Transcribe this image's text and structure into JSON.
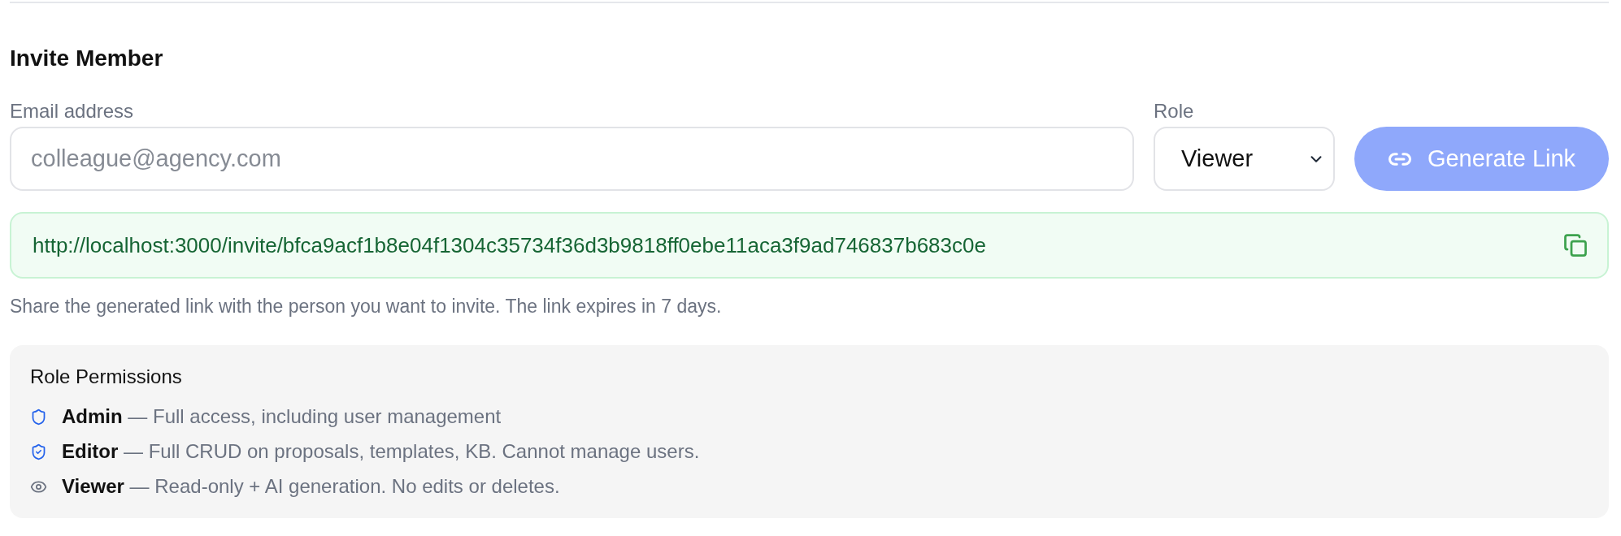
{
  "section": {
    "title": "Invite Member"
  },
  "form": {
    "email": {
      "label": "Email address",
      "placeholder": "colleague@agency.com"
    },
    "role": {
      "label": "Role",
      "value": "Viewer"
    },
    "generate_button": {
      "label": "Generate Link",
      "disabled": true
    }
  },
  "invite_link": {
    "url": "http://localhost:3000/invite/bfca9acf1b8e04f1304c35734f36d3b9818ff0ebe11aca3f9ad746837b683c0e"
  },
  "help_text": "Share the generated link with the person you want to invite. The link expires in 7 days.",
  "permissions": {
    "title": "Role Permissions",
    "items": [
      {
        "kind": "admin",
        "text": "**Admin** — Full access, including user management"
      },
      {
        "kind": "editor",
        "text": "**Editor** — Full CRUD on proposals, templates, KB. Cannot manage users."
      },
      {
        "kind": "viewer",
        "text": "**Viewer** — Read-only + AI generation. No edits or deletes."
      }
    ]
  }
}
